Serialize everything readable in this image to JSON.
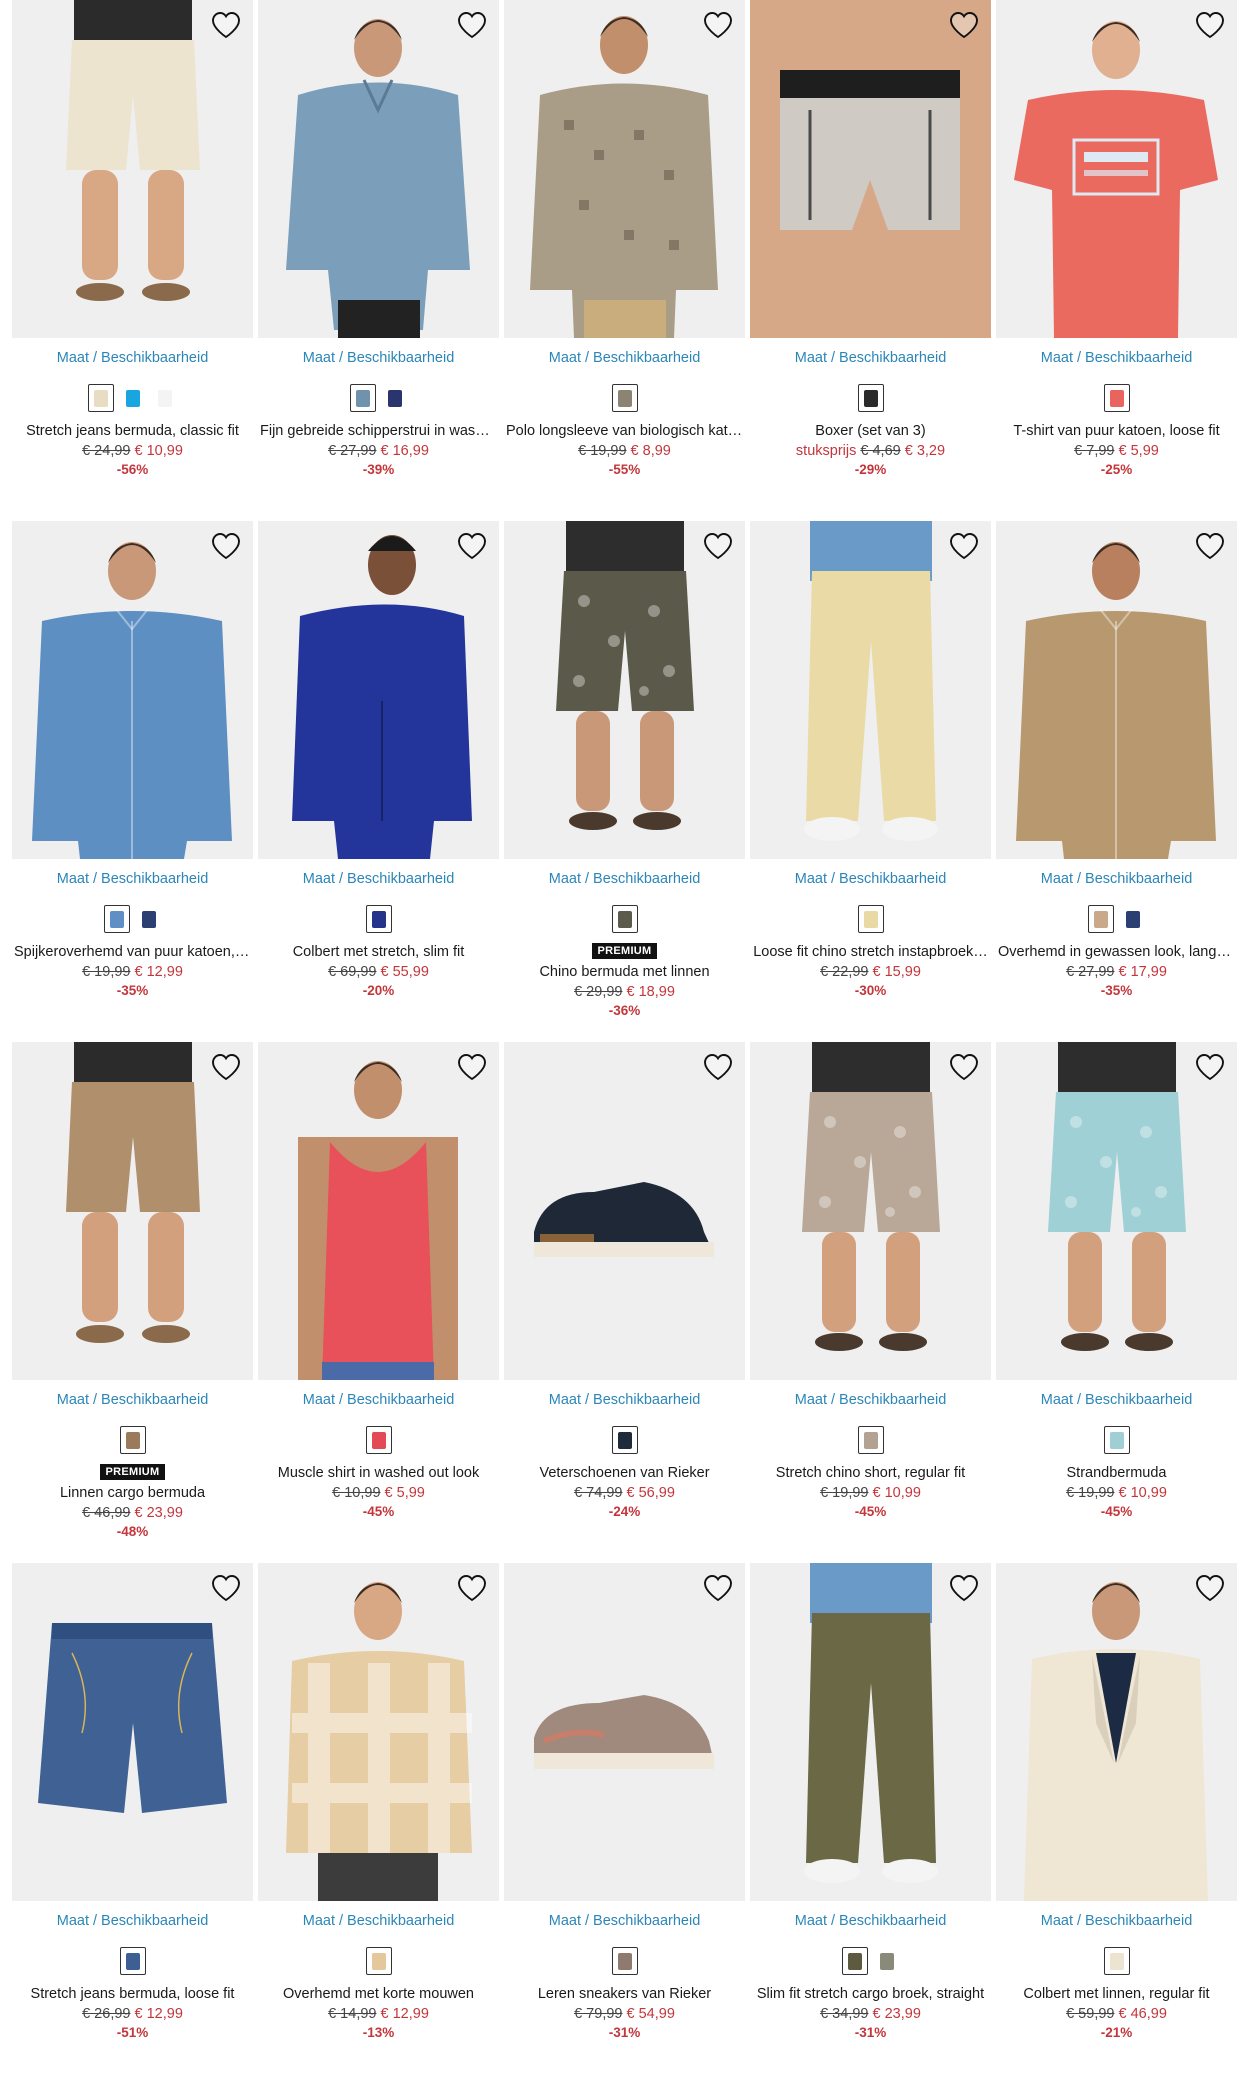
{
  "common": {
    "size_link": "Maat / Beschikbaarheid",
    "premium_badge": "PREMIUM",
    "unit_price_label": "stuksprijs"
  },
  "colors": {
    "link": "#2b86b8",
    "sale": "#c3363b",
    "text": "#1a1a1a",
    "photo_bg": "#efefef"
  },
  "products": [
    {
      "title": "Stretch jeans bermuda, classic fit",
      "old_price": "€ 24,99",
      "new_price": "€ 10,99",
      "discount": "-56%",
      "premium": false,
      "unit_label": false,
      "swatches": [
        "#e8dcc2",
        "#19a6e0",
        "#f4f4f4"
      ],
      "art": "shorts",
      "color": "#ece4cf",
      "skin": "#d8a784"
    },
    {
      "title": "Fijn gebreide schipperstrui in wash…",
      "old_price": "€ 27,99",
      "new_price": "€ 16,99",
      "discount": "-39%",
      "premium": false,
      "unit_label": false,
      "swatches": [
        "#6f93ad",
        "#2a3570"
      ],
      "art": "sweater",
      "color": "#7b9fbb",
      "skin": "#c99878"
    },
    {
      "title": "Polo longsleeve van biologisch kato…",
      "old_price": "€ 19,99",
      "new_price": "€ 8,99",
      "discount": "-55%",
      "premium": false,
      "unit_label": false,
      "swatches": [
        "#8d8373"
      ],
      "art": "polo",
      "color": "#a99d88",
      "skin": "#c28f6c"
    },
    {
      "title": "Boxer (set van 3)",
      "old_price": "€ 4,69",
      "new_price": "€ 3,29",
      "discount": "-29%",
      "premium": false,
      "unit_label": true,
      "swatches": [
        "#2a2a2a"
      ],
      "art": "boxer",
      "color": "#cfcac4",
      "skin": "#d6a888"
    },
    {
      "title": "T-shirt van puur katoen, loose fit",
      "old_price": "€ 7,99",
      "new_price": "€ 5,99",
      "discount": "-25%",
      "premium": false,
      "unit_label": false,
      "swatches": [
        "#e8645d"
      ],
      "art": "tshirt",
      "color": "#ea6a60",
      "skin": "#e0b090"
    },
    {
      "title": "Spijkeroverhemd van puur katoen, …",
      "old_price": "€ 19,99",
      "new_price": "€ 12,99",
      "discount": "-35%",
      "premium": false,
      "unit_label": false,
      "swatches": [
        "#5f8fc4",
        "#2b3f73"
      ],
      "art": "shirt",
      "color": "#5d8fc3",
      "skin": "#c99878"
    },
    {
      "title": "Colbert met stretch, slim fit",
      "old_price": "€ 69,99",
      "new_price": "€ 55,99",
      "discount": "-20%",
      "premium": false,
      "unit_label": false,
      "swatches": [
        "#23348a"
      ],
      "art": "blazer_back",
      "color": "#23359a",
      "skin": "#7a5038"
    },
    {
      "title": "Chino bermuda met linnen",
      "old_price": "€ 29,99",
      "new_price": "€ 18,99",
      "discount": "-36%",
      "premium": true,
      "unit_label": false,
      "swatches": [
        "#5a5b4a"
      ],
      "art": "shorts_pattern",
      "color": "#5b5a4a",
      "skin": "#c99878"
    },
    {
      "title": "Loose fit chino stretch instapbroek…",
      "old_price": "€ 22,99",
      "new_price": "€ 15,99",
      "discount": "-30%",
      "premium": false,
      "unit_label": false,
      "swatches": [
        "#e9d9a4"
      ],
      "art": "trousers",
      "color": "#eadba6",
      "skin": "#c99878"
    },
    {
      "title": "Overhemd in gewassen look, lange …",
      "old_price": "€ 27,99",
      "new_price": "€ 17,99",
      "discount": "-35%",
      "premium": false,
      "unit_label": false,
      "swatches": [
        "#caa98a",
        "#2b3f73"
      ],
      "art": "shirt",
      "color": "#b8996f",
      "skin": "#b98060"
    },
    {
      "title": "Linnen cargo bermuda",
      "old_price": "€ 46,99",
      "new_price": "€ 23,99",
      "discount": "-48%",
      "premium": true,
      "unit_label": false,
      "swatches": [
        "#9a7a5a"
      ],
      "art": "shorts",
      "color": "#b08f6c",
      "skin": "#d3a07e"
    },
    {
      "title": "Muscle shirt in washed out look",
      "old_price": "€ 10,99",
      "new_price": "€ 5,99",
      "discount": "-45%",
      "premium": false,
      "unit_label": false,
      "swatches": [
        "#e24a55"
      ],
      "art": "tank",
      "color": "#e8505a",
      "skin": "#c28f6c"
    },
    {
      "title": "Veterschoenen van Rieker",
      "old_price": "€ 74,99",
      "new_price": "€ 56,99",
      "discount": "-24%",
      "premium": false,
      "unit_label": false,
      "swatches": [
        "#1f2a3a"
      ],
      "art": "shoe_dark",
      "color": "#1f2836",
      "skin": "#8a6238"
    },
    {
      "title": "Stretch chino short, regular fit",
      "old_price": "€ 19,99",
      "new_price": "€ 10,99",
      "discount": "-45%",
      "premium": false,
      "unit_label": false,
      "swatches": [
        "#b3a291"
      ],
      "art": "shorts_pattern",
      "color": "#b9a897",
      "skin": "#d3a07e"
    },
    {
      "title": "Strandbermuda",
      "old_price": "€ 19,99",
      "new_price": "€ 10,99",
      "discount": "-45%",
      "premium": false,
      "unit_label": false,
      "swatches": [
        "#9fcfd4"
      ],
      "art": "shorts_pattern",
      "color": "#9fd0d6",
      "skin": "#d3a07e"
    },
    {
      "title": "Stretch jeans bermuda, loose fit",
      "old_price": "€ 26,99",
      "new_price": "€ 12,99",
      "discount": "-51%",
      "premium": false,
      "unit_label": false,
      "swatches": [
        "#3e5f92"
      ],
      "art": "denim_flat",
      "color": "#3f6193",
      "skin": "#d3a07e"
    },
    {
      "title": "Overhemd met korte mouwen",
      "old_price": "€ 14,99",
      "new_price": "€ 12,99",
      "discount": "-13%",
      "premium": false,
      "unit_label": false,
      "swatches": [
        "#e4c79a"
      ],
      "art": "check_shirt",
      "color": "#e6cda3",
      "skin": "#d8a784"
    },
    {
      "title": "Leren sneakers van Rieker",
      "old_price": "€ 79,99",
      "new_price": "€ 54,99",
      "discount": "-31%",
      "premium": false,
      "unit_label": false,
      "swatches": [
        "#8f7a70"
      ],
      "art": "sneaker",
      "color": "#a08a7e",
      "skin": "#c57f6a"
    },
    {
      "title": "Slim fit stretch cargo broek, straight",
      "old_price": "€ 34,99",
      "new_price": "€ 23,99",
      "discount": "-31%",
      "premium": false,
      "unit_label": false,
      "swatches": [
        "#5d5a40",
        "#8a8a7a"
      ],
      "art": "trousers",
      "color": "#6b6846",
      "skin": "#c99878"
    },
    {
      "title": "Colbert met linnen, regular fit",
      "old_price": "€ 59,99",
      "new_price": "€ 46,99",
      "discount": "-21%",
      "premium": false,
      "unit_label": false,
      "swatches": [
        "#ece3d0"
      ],
      "art": "blazer_front",
      "color": "#efe6d4",
      "skin": "#c99878"
    }
  ]
}
